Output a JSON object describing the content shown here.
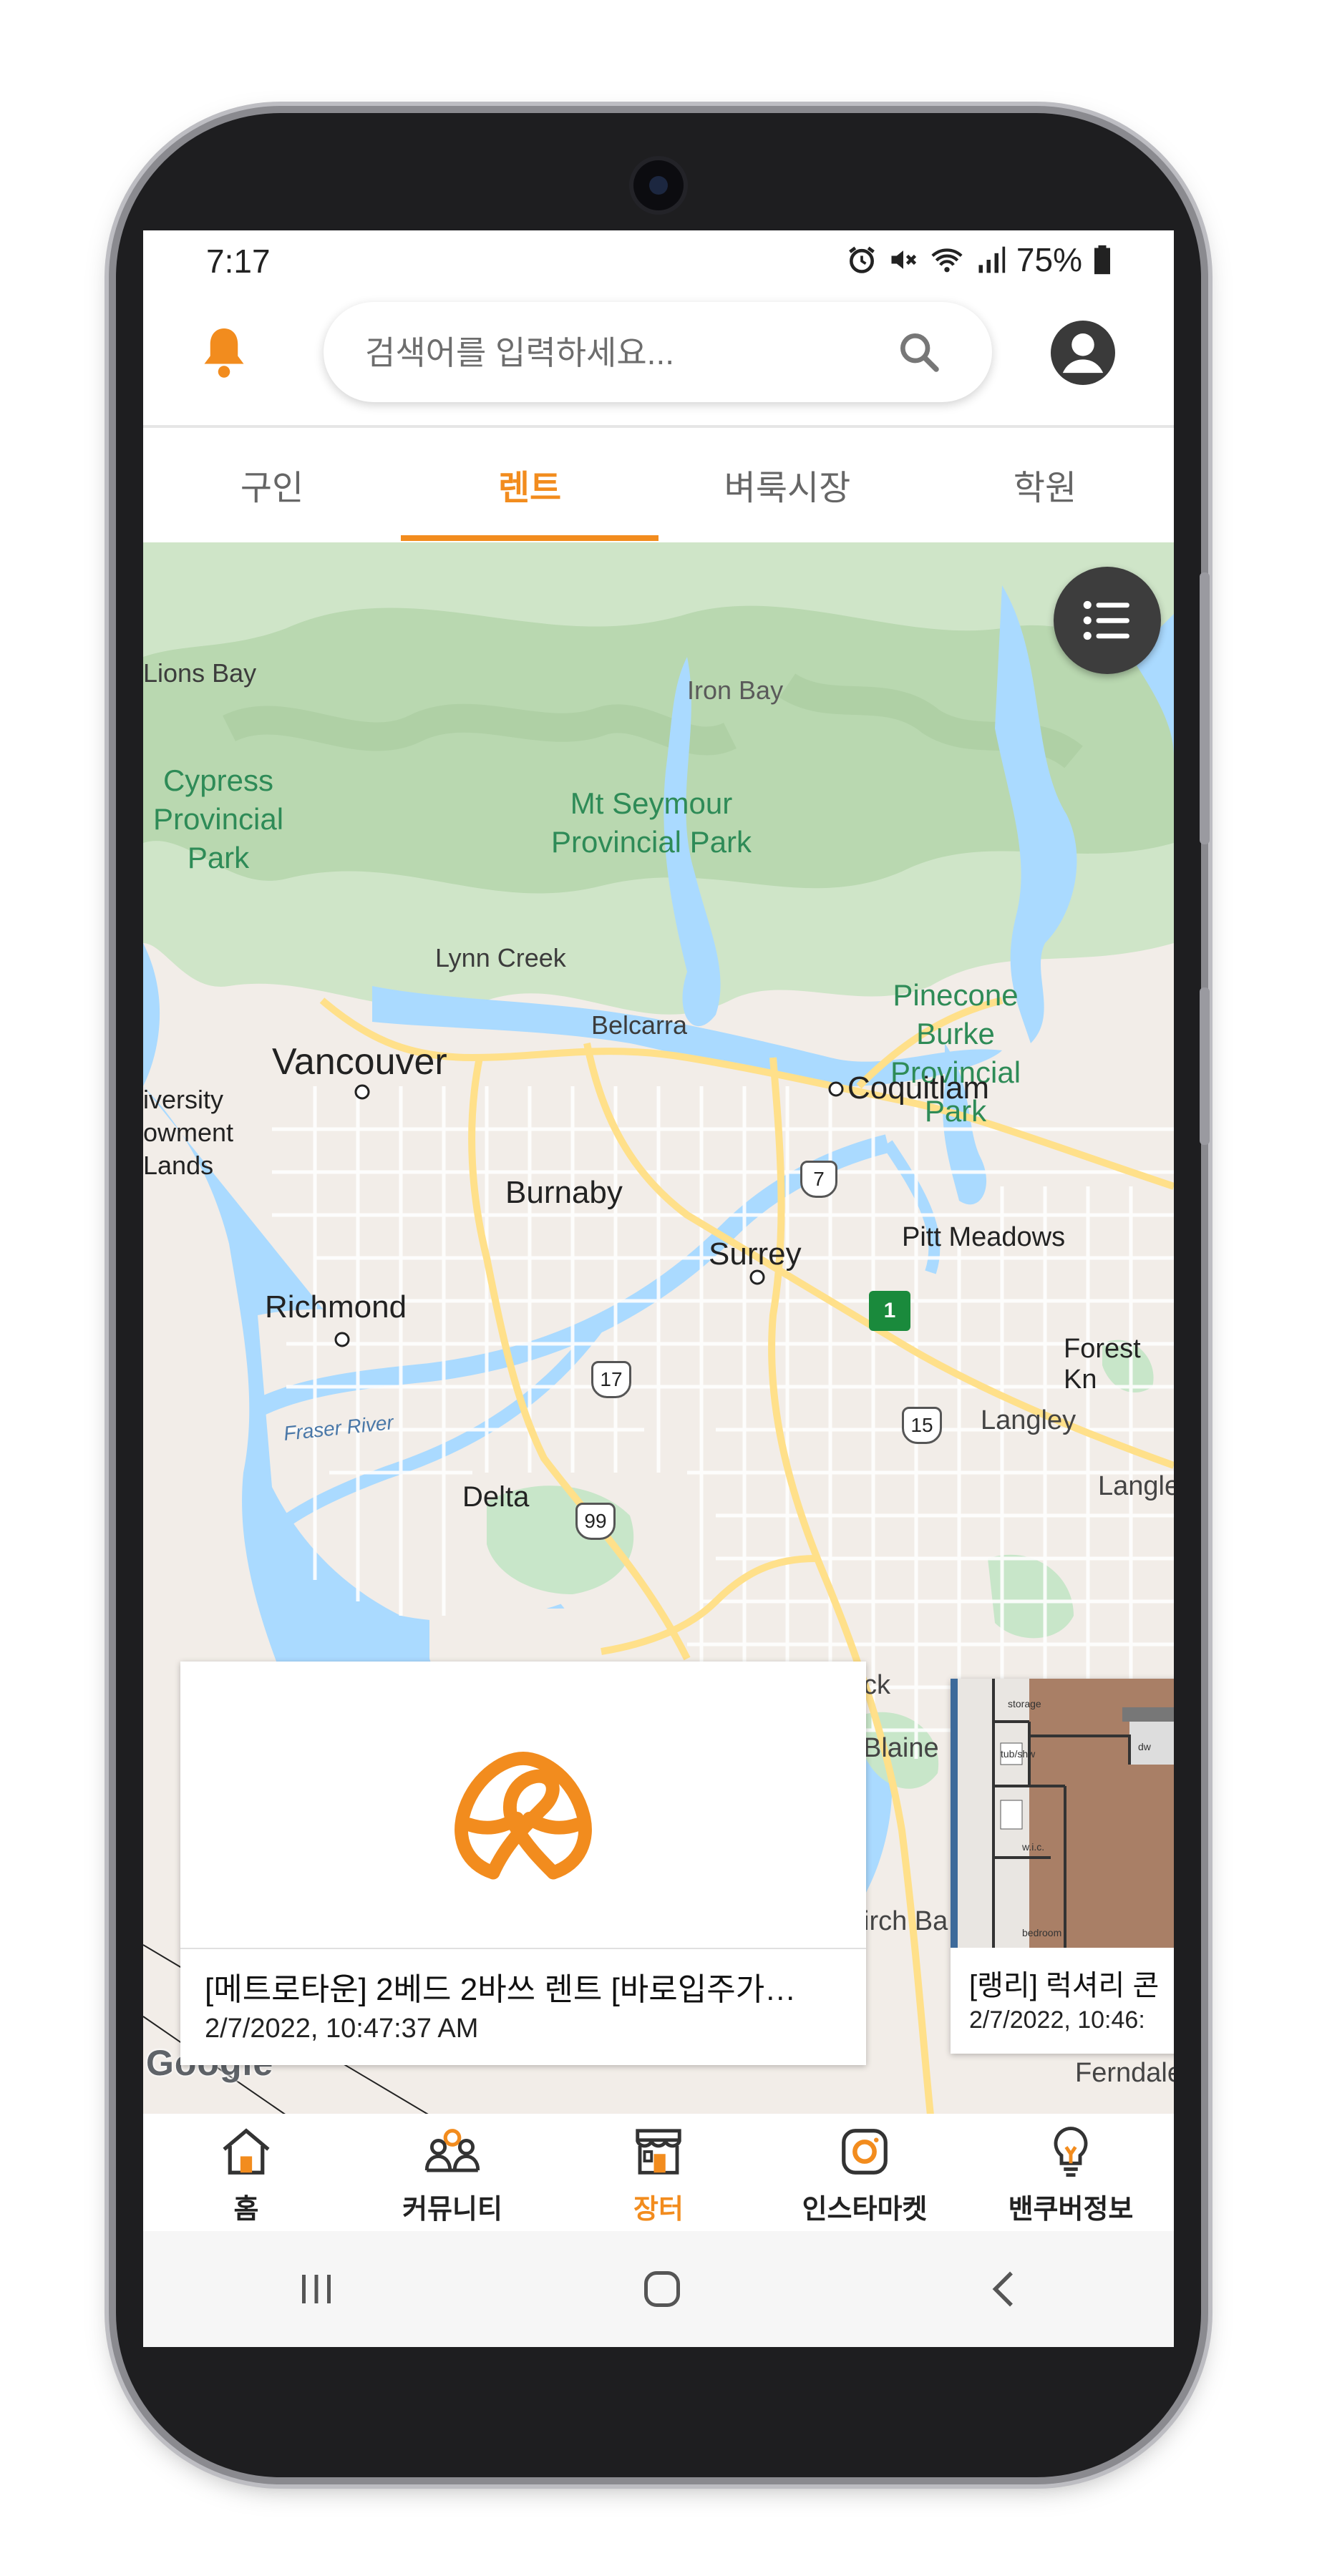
{
  "status_bar": {
    "time": "7:17",
    "battery": "75%"
  },
  "header": {
    "search_placeholder": "검색어를 입력하세요..."
  },
  "tabs": [
    {
      "label": "구인",
      "active": false
    },
    {
      "label": "렌트",
      "active": true
    },
    {
      "label": "벼룩시장",
      "active": false
    },
    {
      "label": "학원",
      "active": false
    }
  ],
  "map": {
    "labels": {
      "lions_bay": "Lions Bay",
      "iron_bay": "Iron Bay",
      "cypress": "Cypress Provincial Park",
      "seymour": "Mt Seymour Provincial Park",
      "pinecone": "Pinecone Burke Provincial Park",
      "lynn_creek": "Lynn Creek",
      "belcarra": "Belcarra",
      "vancouver": "Vancouver",
      "coquitlam": "Coquitlam",
      "ubc": "iversity owment Lands",
      "burnaby": "Burnaby",
      "pitt_meadows": "Pitt Meadows",
      "surrey": "Surrey",
      "richmond": "Richmond",
      "forest": "Forest Kn",
      "fraser": "Fraser River",
      "langley": "Langley",
      "delta": "Delta",
      "langley2": "Langle",
      "ck": "ck",
      "blaine": "Blaine",
      "birch_bay": "irch Ba",
      "ferndale": "Ferndale",
      "google": "Google",
      "shield_7": "7",
      "shield_17": "17",
      "shield_15": "15",
      "shield_99": "99",
      "shield_1": "1"
    },
    "floorplan": {
      "storage": "storage",
      "tub": "tub/shw",
      "wic": "w.i.c.",
      "bedroom": "bedroom",
      "dw": "dw"
    }
  },
  "cards": [
    {
      "title": "[메트로타운] 2베드 2바쓰 렌트 [바로입주가…",
      "date": "2/7/2022, 10:47:37 AM"
    },
    {
      "title": "[랭리] 럭셔리 콘",
      "date": "2/7/2022, 10:46:"
    }
  ],
  "bottom_nav": [
    {
      "label": "홈",
      "icon": "home-icon"
    },
    {
      "label": "커뮤니티",
      "icon": "community-icon"
    },
    {
      "label": "장터",
      "icon": "store-icon",
      "active": true
    },
    {
      "label": "인스타마켓",
      "icon": "instagram-icon"
    },
    {
      "label": "밴쿠버정보",
      "icon": "lightbulb-icon"
    }
  ],
  "colors": {
    "accent": "#f28c1e",
    "water": "#aadaff",
    "park": "#c8e6c9",
    "land": "#f5f0eb"
  }
}
